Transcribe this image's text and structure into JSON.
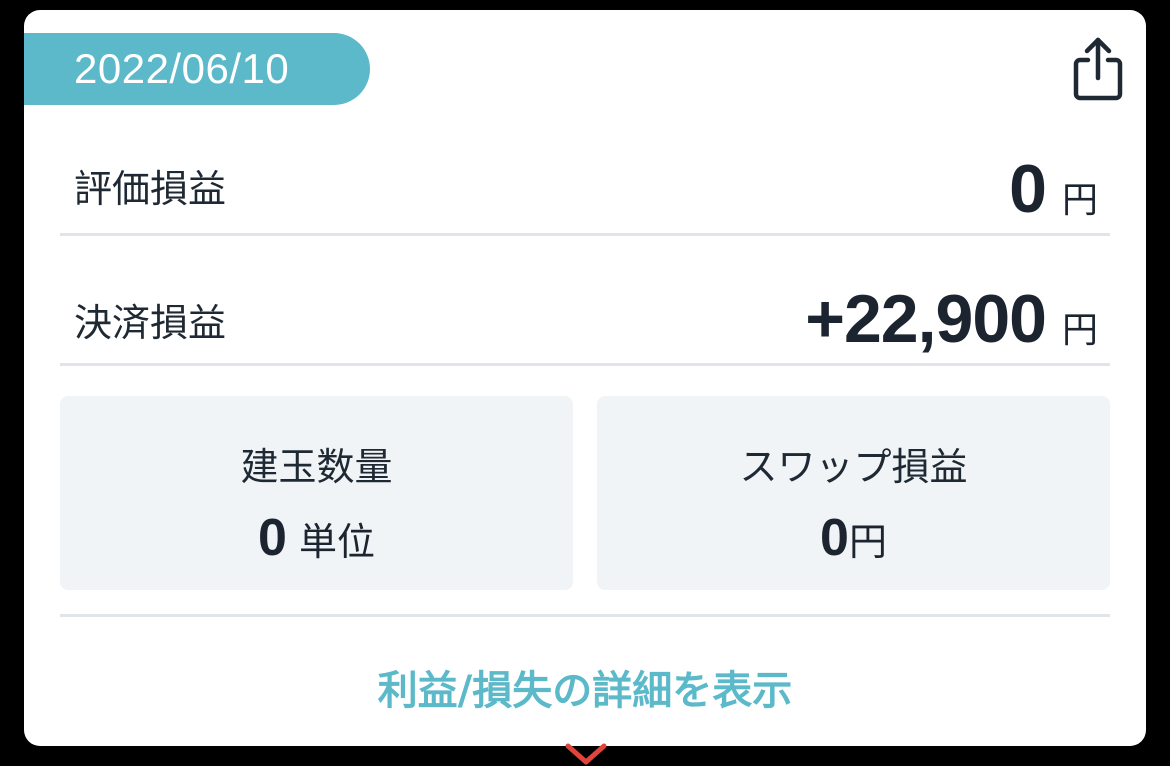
{
  "card": {
    "date": "2022/06/10",
    "share_icon": "share-icon"
  },
  "rows": {
    "unrealized": {
      "label": "評価損益",
      "value": "0",
      "unit": "円"
    },
    "realized": {
      "label": "決済損益",
      "value": "+22,900",
      "unit": "円"
    }
  },
  "boxes": {
    "position_qty": {
      "label": "建玉数量",
      "value": "0",
      "unit": "単位"
    },
    "swap": {
      "label": "スワップ損益",
      "value": "0",
      "unit": "円"
    }
  },
  "detail_link": "利益/損失の詳細を表示",
  "colors": {
    "accent": "#5bb9c9",
    "chevron": "#e0443a",
    "text": "#1c2430",
    "box_bg": "#f1f4f6"
  }
}
